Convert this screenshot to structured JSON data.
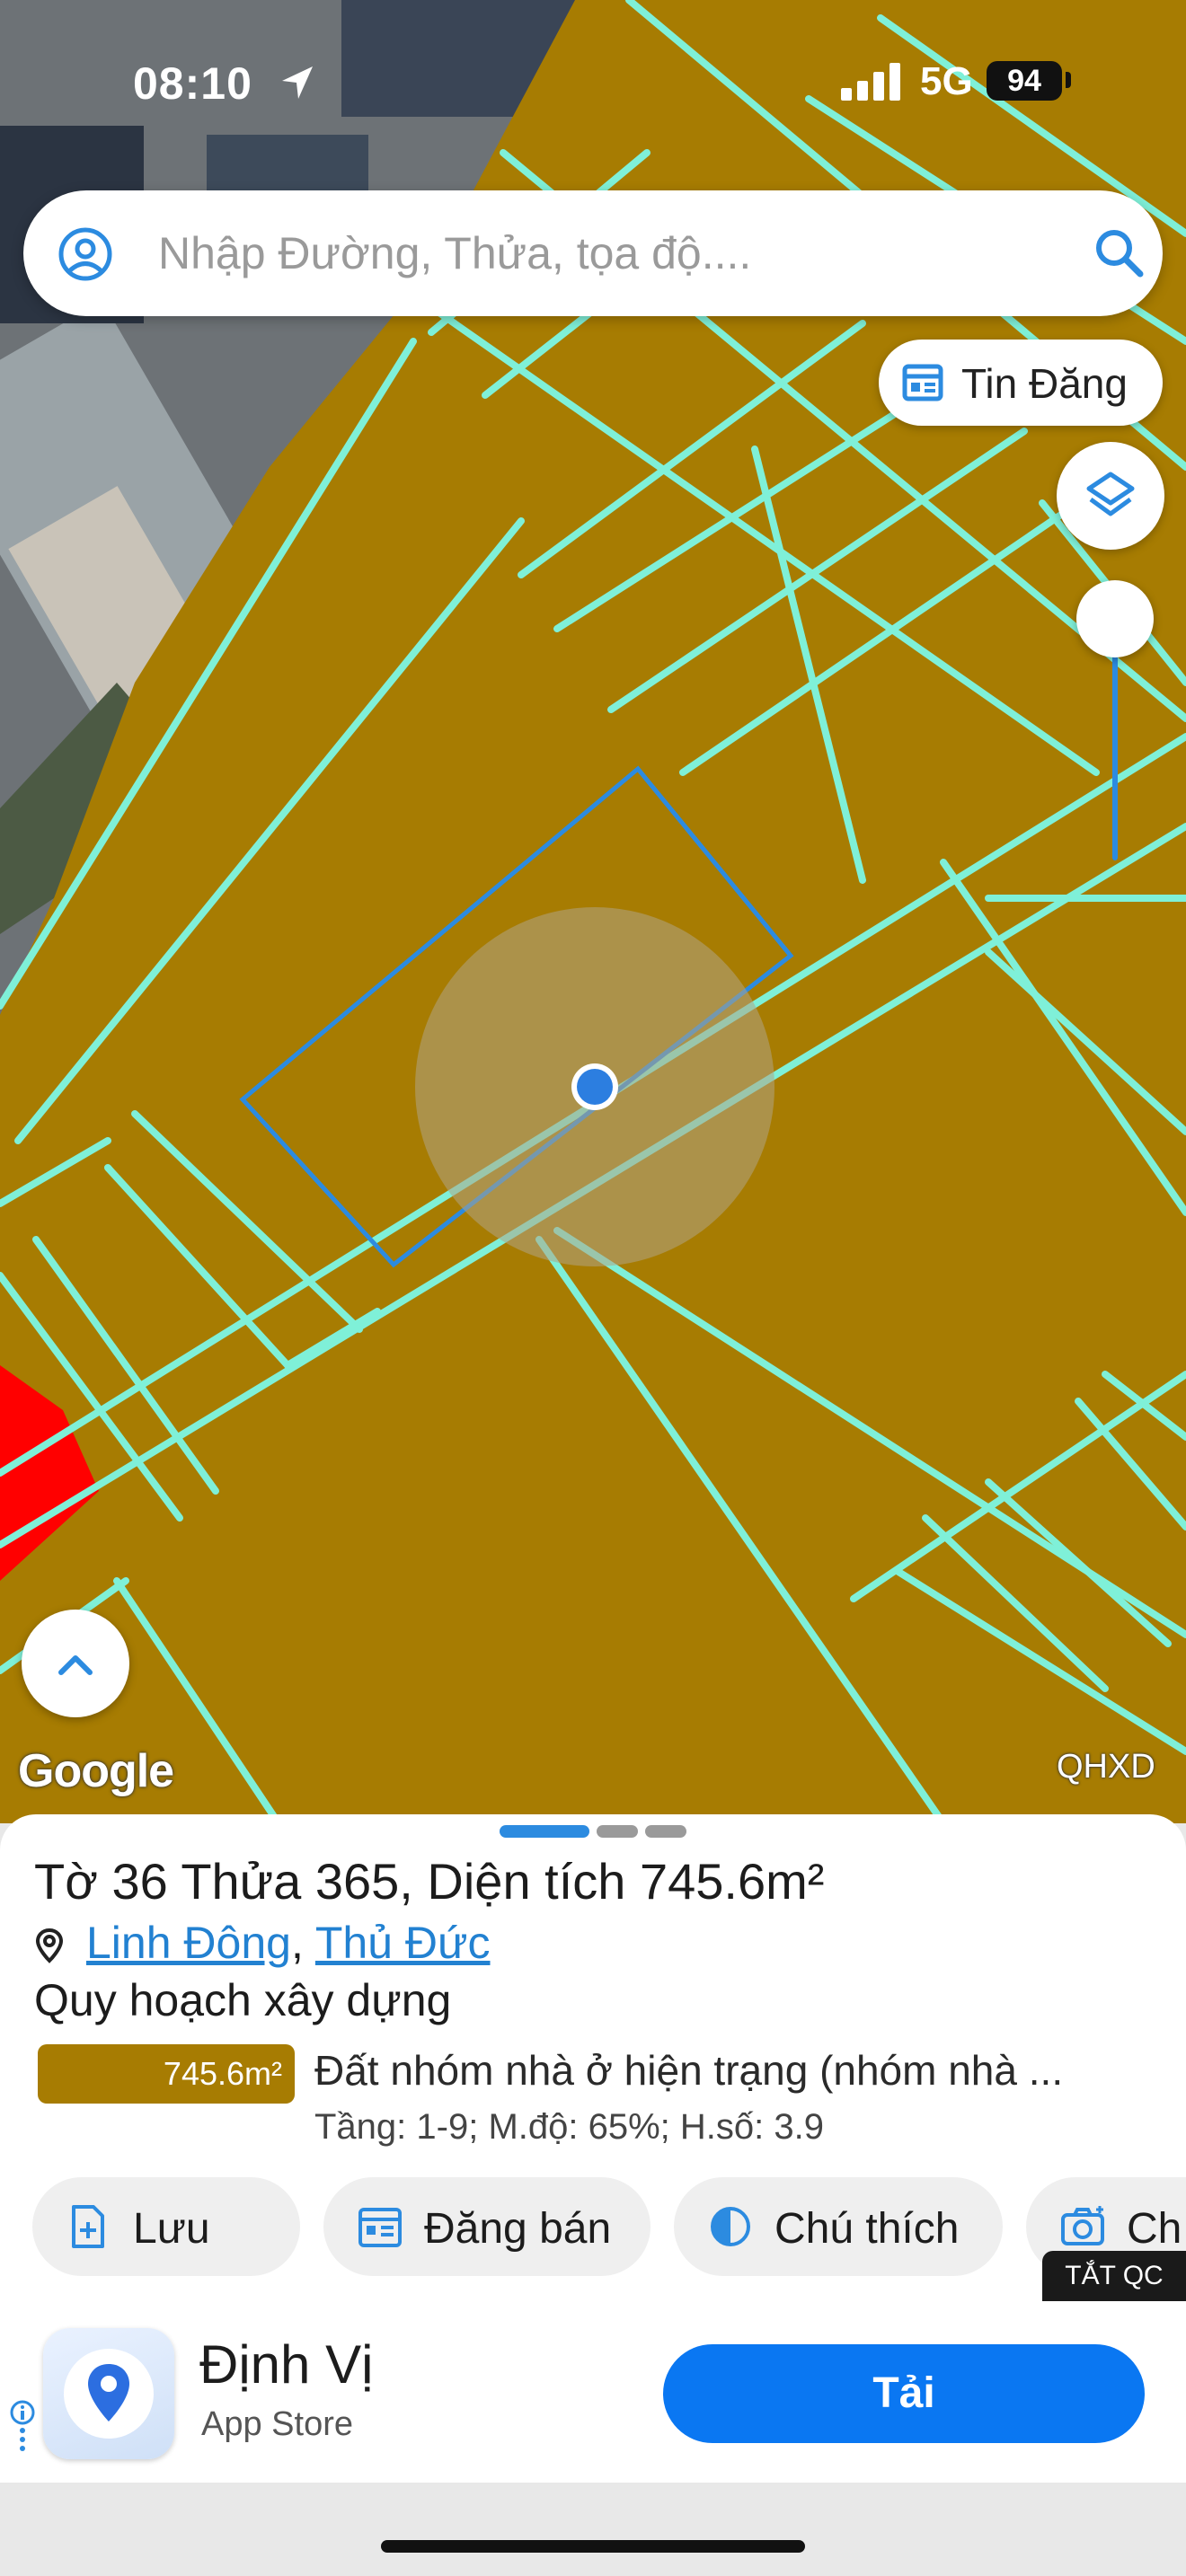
{
  "status_bar": {
    "time": "08:10",
    "network": "5G",
    "battery": "94"
  },
  "search": {
    "placeholder": "Nhập Đường, Thửa, tọa độ...."
  },
  "map": {
    "parcel_color": "#a77c02",
    "boundary_color": "#7ff0d8",
    "selection_color": "#2c8be0",
    "google_label": "Google",
    "layer_label": "QHXD",
    "tin_dang_label": "Tin Đăng"
  },
  "sheet": {
    "title": "Tờ 36 Thửa 365, Diện tích 745.6m²",
    "ward": "Linh Đông",
    "separator": ",",
    "district": "Thủ Đức",
    "section_title": "Quy hoạch xây dựng",
    "zone_area": "745.6m²",
    "zone_description": "Đất nhóm nhà ở hiện trạng (nhóm nhà ...",
    "zone_info": "Tầng: 1-9; M.độ: 65%; H.số: 3.9",
    "actions": [
      {
        "label": "Lưu",
        "icon": "save-icon"
      },
      {
        "label": "Đăng bán",
        "icon": "listing-icon"
      },
      {
        "label": "Chú thích",
        "icon": "legend-icon"
      },
      {
        "label": "Ch",
        "icon": "camera-icon"
      }
    ]
  },
  "ad": {
    "close_label": "TẮT QC",
    "app_name": "Định Vị",
    "store": "App Store",
    "cta": "Tải"
  }
}
